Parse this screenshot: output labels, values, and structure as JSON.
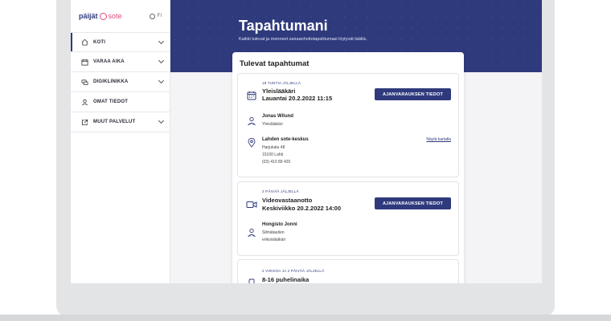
{
  "brand": {
    "logo_main": "päijät",
    "logo_sub": "sote",
    "lang": "FI"
  },
  "sidebar": {
    "items": [
      {
        "label": "KOTI",
        "icon": "home-icon",
        "has_chevron": true,
        "active": true
      },
      {
        "label": "VARAA AIKA",
        "icon": "calendar-icon",
        "has_chevron": true,
        "active": false
      },
      {
        "label": "DIGIKLINIKKA",
        "icon": "chat-icon",
        "has_chevron": true,
        "active": false
      },
      {
        "label": "OMAT TIEDOT",
        "icon": "person-icon",
        "has_chevron": false,
        "active": false
      },
      {
        "label": "MUUT PALVELUT",
        "icon": "external-link-icon",
        "has_chevron": true,
        "active": false
      }
    ]
  },
  "hero": {
    "title": "Tapahtumani",
    "subtitle": "Kaikki tulevat ja menneet sairaanhoitotapahtumasi löytyvät täältä."
  },
  "panel": {
    "title": "Tulevat tapahtumat"
  },
  "events": [
    {
      "badge": "18 TUNTIA JÄLJELLÄ",
      "title": "Yleislääkäri",
      "datetime": "Lauantai 20.2.2022 11:15",
      "button": "AJANVARAUKSEN TIEDOT",
      "person": "Jonas Wilund",
      "person_role": "Yleislääkäri",
      "location": "Lahden sote-keskus",
      "address": "Harjukatu 48",
      "postal": "15100 Lahti",
      "phone": "(03) 410 89 420",
      "map_link": "Näytä kartalla"
    },
    {
      "badge": "2 PÄIVÄÄ JÄLJELLÄ",
      "title": "Videovastaanotto",
      "datetime": "Keskiviikko 20.2.2022  14:00",
      "button": "AJANVARAUKSEN TIEDOT",
      "person": "Hongisto Jonni",
      "person_role_1": "Silmätautien",
      "person_role_2": "erikoislääkäri"
    },
    {
      "badge": "2 VIIKKOA JA 2 PÄIVÄÄ JÄLJELLÄ",
      "title": "8-16 puhelinaika"
    }
  ],
  "colors": {
    "brand_navy": "#2f3a7d",
    "brand_pink": "#e04a7a",
    "page_bg": "#f4f4f6"
  }
}
